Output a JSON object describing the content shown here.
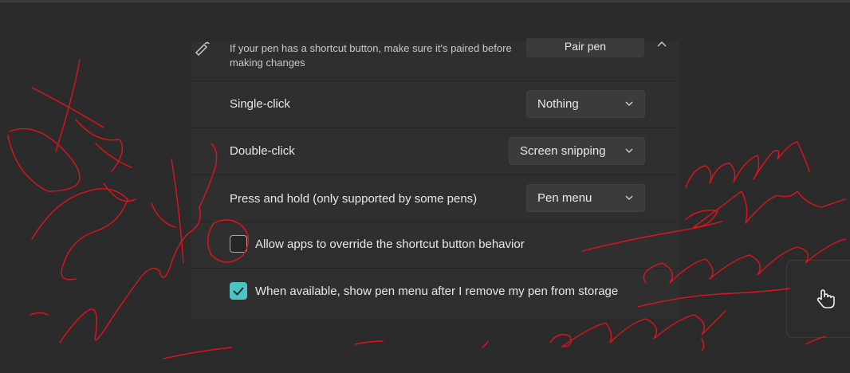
{
  "pair_row": {
    "info": "If your pen has a shortcut button, make sure it's paired before making changes",
    "button": "Pair pen",
    "pen_icon": "pen-icon",
    "collapse_icon": "chevron-up-icon"
  },
  "settings": [
    {
      "label": "Single-click",
      "value": "Nothing"
    },
    {
      "label": "Double-click",
      "value": "Screen snipping"
    },
    {
      "label": "Press and hold (only supported by some pens)",
      "value": "Pen menu"
    }
  ],
  "checkboxes": [
    {
      "label": "Allow apps to override the shortcut button behavior",
      "checked": false
    },
    {
      "label": "When available, show pen menu after I remove my pen from storage",
      "checked": true
    }
  ],
  "floating": {
    "icon": "touch-hand-icon"
  },
  "colors": {
    "accent": "#4cc2c4",
    "ink": "#e0141c",
    "background": "#2b2b2b"
  }
}
